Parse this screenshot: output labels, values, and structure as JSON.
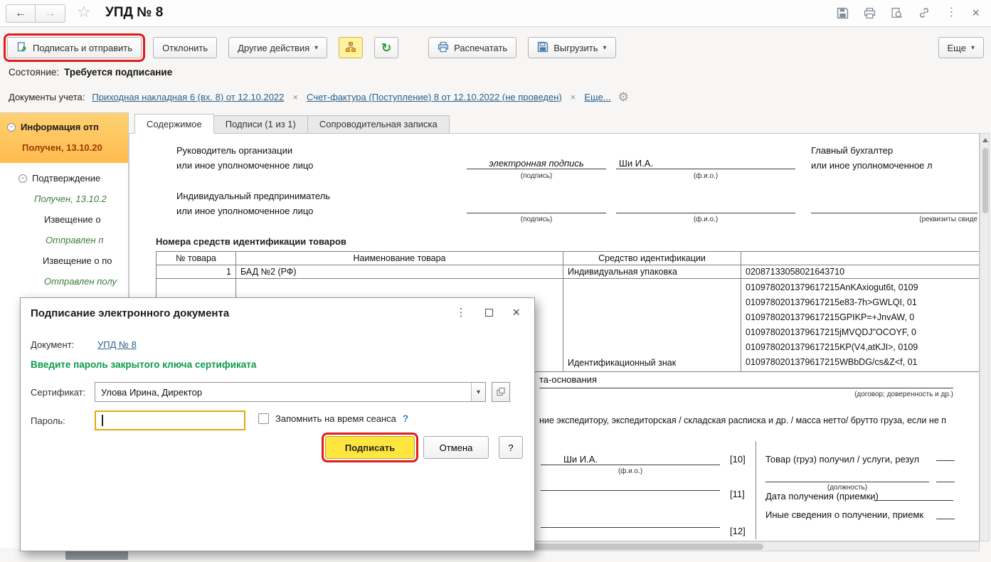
{
  "icons": {
    "back": "←",
    "forward": "→",
    "star": "☆",
    "kebab": "⋮",
    "close": "×",
    "dropdown": "▾",
    "refresh": "↻",
    "gear": "⚙",
    "remove": "×",
    "minus": "−",
    "help": "?"
  },
  "window": {
    "title": "УПД № 8"
  },
  "toolbar": {
    "sign_send": "Подписать и отправить",
    "decline": "Отклонить",
    "other_actions": "Другие действия",
    "print": "Распечатать",
    "export": "Выгрузить",
    "more": "Еще"
  },
  "status": {
    "label": "Состояние:",
    "value": "Требуется подписание"
  },
  "docs": {
    "label": "Документы учета:",
    "links": [
      "Приходная накладная 6 (вх. 8) от 12.10.2022",
      "Счет-фактура (Поступление) 8 от 12.10.2022 (не проведен)"
    ],
    "more_link": "Еще..."
  },
  "tree": {
    "items": [
      {
        "label": "Информация отп",
        "status": "Получен, 13.10.20"
      },
      {
        "label": "Подтверждение",
        "status": "Получен, 13.10.2"
      },
      {
        "label": "Извещение о",
        "status": "Отправлен п"
      },
      {
        "label": "Извещение о по",
        "status": "Отправлен полу"
      }
    ]
  },
  "tabs": [
    "Содержимое",
    "Подписи (1 из 1)",
    "Сопроводительная записка"
  ],
  "form": {
    "director_line1": "Руководитель организации",
    "director_line2": "или иное уполномоченное лицо",
    "esign_value": "электронная подпись",
    "sign_caption": "(подпись)",
    "fio_value": "Ши И.А.",
    "fio_caption": "(ф.и.о.)",
    "accountant_line1": "Главный бухгалтер",
    "accountant_line2": "или иное уполномоченное л",
    "ip_line1": "Индивидуальный предприниматель",
    "ip_line2": "или иное уполномоченное лицо",
    "requisites_caption": "(реквизиты свиде",
    "ident_title": "Номера средств идентификации товаров",
    "table": {
      "col_num": "№ товара",
      "col_name": "Наименование товара",
      "col_ident": "Средство идентификации",
      "row1_num": "1",
      "row1_name": "БАД №2 (РФ)",
      "row1_ident": "Индивидуальная упаковка",
      "row1_code": "02087133058021643710",
      "row2_ident": "Идентификационный знак",
      "codes": [
        "0109780201379617215AnKAxiogut6t, 0109",
        "0109780201379617215e83-7h>GWLQI, 01",
        "0109780201379617215GPIKP=+JnvAW, 0",
        "0109780201379617215jMVQDJ\"OCOYF, 0",
        "0109780201379617215KP(V4,atKJI>, 0109",
        "0109780201379617215WBbDG/cs&Z<f, 01"
      ]
    },
    "basis_fragment": "та-основания",
    "basis_caption": "(договор; доверенность и др.)",
    "cargo_fragment": "ние экспедитору, экспедиторская / складская расписка и др. / масса нетто/ брутто груза, если не п",
    "fio2_value": "Ши И.А.",
    "ref10": "[10]",
    "ref11": "[11]",
    "ref12": "[12]",
    "received_title": "Товар (груз) получил / услуги, резул",
    "position_caption": "(должность)",
    "date_label": "Дата получения (приемки)",
    "other_info_label": "Иные сведения о получении, приемк"
  },
  "dialog": {
    "title": "Подписание электронного документа",
    "doc_label": "Документ:",
    "doc_link": "УПД № 8",
    "prompt": "Введите пароль закрытого ключа сертификата",
    "cert_label": "Сертификат:",
    "cert_value": "Улова Ирина, Директор",
    "password_label": "Пароль:",
    "remember_label": "Запомнить на время сеанса",
    "sign_button": "Подписать",
    "cancel_button": "Отмена"
  }
}
